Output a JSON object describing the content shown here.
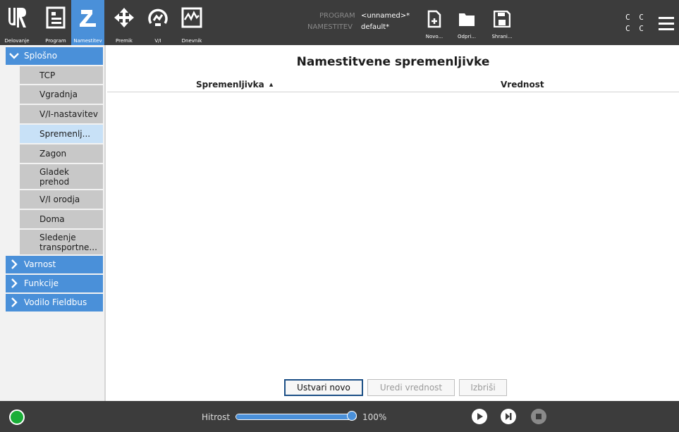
{
  "colors": {
    "accent": "#4a90d9",
    "header_bg": "#3c3c3c",
    "selected_bg": "#c8e1f7",
    "status_ok": "#1aae38"
  },
  "header": {
    "nav": [
      {
        "label": "Delovanje",
        "icon": "ur-logo-icon"
      },
      {
        "label": "Program",
        "icon": "program-icon"
      },
      {
        "label": "Namestitev",
        "icon": "installation-icon"
      },
      {
        "label": "Premik",
        "icon": "move-icon"
      },
      {
        "label": "V/I",
        "icon": "io-icon"
      },
      {
        "label": "Dnevnik",
        "icon": "log-icon"
      }
    ],
    "program_label": "PROGRAM",
    "program_value": "<unnamed>*",
    "installation_label": "NAMESTITEV",
    "installation_value": "default*",
    "file_buttons": [
      {
        "label": "Novo...",
        "icon": "new-file-icon"
      },
      {
        "label": "Odpri...",
        "icon": "folder-icon"
      },
      {
        "label": "Shrani...",
        "icon": "save-icon"
      }
    ],
    "cc_row1": "C C",
    "cc_row2": "C C"
  },
  "sidebar": {
    "sections": [
      {
        "label": "Splošno",
        "expanded": true
      },
      {
        "label": "Varnost",
        "expanded": false
      },
      {
        "label": "Funkcije",
        "expanded": false
      },
      {
        "label": "Vodilo Fieldbus",
        "expanded": false
      }
    ],
    "items": [
      {
        "label": "TCP"
      },
      {
        "label": "Vgradnja"
      },
      {
        "label": "V/I-nastavitev"
      },
      {
        "label": "Spremenlj...",
        "selected": true
      },
      {
        "label": "Zagon"
      },
      {
        "label": "Gladek\nprehod"
      },
      {
        "label": "V/I orodja"
      },
      {
        "label": "Doma"
      },
      {
        "label": "Sledenje\ntransportne..."
      }
    ]
  },
  "main": {
    "title": "Namestitvene spremenljivke",
    "columns": {
      "variable": "Spremenljivka",
      "sort_glyph": "▲",
      "value": "Vrednost"
    },
    "buttons": {
      "create": "Ustvari novo",
      "edit": "Uredi vrednost",
      "delete": "Izbriši"
    }
  },
  "footer": {
    "speed_label": "Hitrost",
    "speed_fraction": 1.0,
    "speed_value": "100%"
  }
}
